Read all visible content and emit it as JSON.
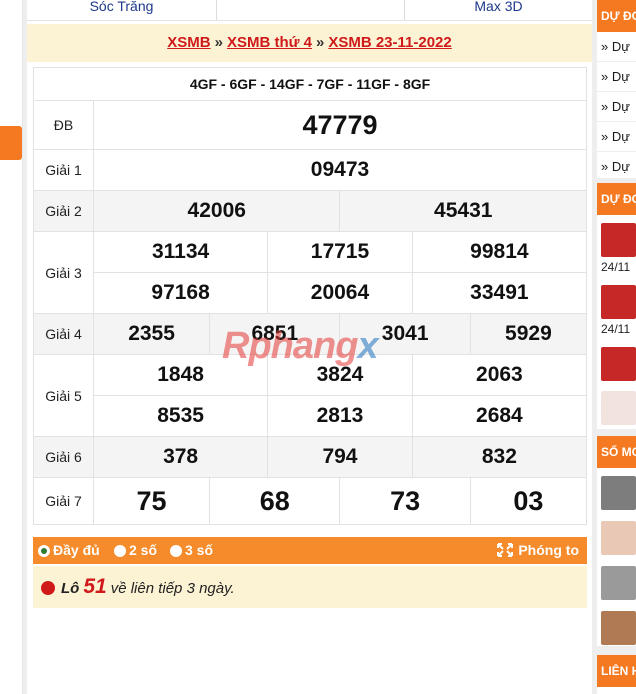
{
  "top_nav": {
    "left": "Sóc Trăng",
    "right": "Max 3D"
  },
  "breadcrumb": {
    "root": "XSMB",
    "weekday": "XSMB thứ 4",
    "date": "XSMB 23-11-2022",
    "separator": "»"
  },
  "codes": "4GF - 6GF - 14GF - 7GF - 11GF - 8GF",
  "prizes": {
    "db": {
      "label": "ĐB",
      "value": "47779"
    },
    "g1": {
      "label": "Giải 1",
      "value": "09473"
    },
    "g2": {
      "label": "Giải 2",
      "values": [
        "42006",
        "45431"
      ]
    },
    "g3": {
      "label": "Giải 3",
      "values": [
        "31134",
        "17715",
        "99814",
        "97168",
        "20064",
        "33491"
      ]
    },
    "g4": {
      "label": "Giải 4",
      "values": [
        "2355",
        "6851",
        "3041",
        "5929"
      ]
    },
    "g5": {
      "label": "Giải 5",
      "values": [
        "1848",
        "3824",
        "2063",
        "8535",
        "2813",
        "2684"
      ]
    },
    "g6": {
      "label": "Giải 6",
      "values": [
        "378",
        "794",
        "832"
      ]
    },
    "g7": {
      "label": "Giải 7",
      "values": [
        "75",
        "68",
        "73",
        "03"
      ]
    }
  },
  "watermark": {
    "part1": "Rphang",
    "part2": "x"
  },
  "options": {
    "full": "Đầy đủ",
    "two": "2 số",
    "three": "3 số",
    "zoom": "Phóng to",
    "selected": "full"
  },
  "loto": {
    "prefix": "Lô",
    "number": "51",
    "suffix": "về liên tiếp 3 ngày."
  },
  "sidebar": {
    "box1": {
      "title": "DỰ ĐO",
      "items": [
        "» Dự",
        "» Dự",
        "» Dự",
        "» Dự",
        "» Dự"
      ]
    },
    "box2": {
      "title": "DỰ ĐO",
      "dates": [
        "24/11",
        "24/11"
      ]
    },
    "box3": {
      "title": "SỐ MƠ"
    },
    "box4": {
      "title": "LIÊN H"
    }
  },
  "colors": {
    "accent": "#f47920",
    "red": "#d0191b",
    "navy": "#1e3a8a",
    "cream": "#fbf3d3"
  }
}
